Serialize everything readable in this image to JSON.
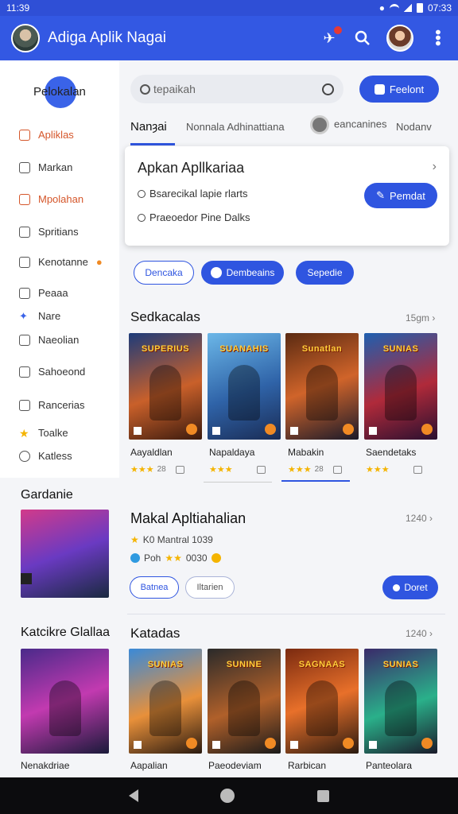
{
  "status": {
    "time": "11:39",
    "right_time": "07:33"
  },
  "appbar": {
    "title": "Adiga Aplik Nagai"
  },
  "sidebar": {
    "logo": "Pelokalan",
    "items": [
      {
        "label": "Apliklas"
      },
      {
        "label": "Markan"
      },
      {
        "label": "Mpolahan"
      },
      {
        "label": "Spritians"
      },
      {
        "label": "Kenotanne"
      },
      {
        "label": "Peaaa"
      },
      {
        "label": "Nare"
      },
      {
        "label": "Naeolian"
      },
      {
        "label": "Sahoeond"
      },
      {
        "label": "Rancerias"
      },
      {
        "label": "Toalke"
      },
      {
        "label": "Katless"
      }
    ]
  },
  "search": {
    "placeholder": "tepaikah",
    "button": "Feelont"
  },
  "tabs": [
    "Nanȝai",
    "Nonnala Adhinattiana",
    "eancanines",
    "Nodanv"
  ],
  "card": {
    "title": "Apkan Apllkariaa",
    "options": [
      "Bsarecikal lapie rlarts",
      "Praeoedor Pine Dalks"
    ],
    "button": "Pemdat"
  },
  "chips": [
    "Dencaka",
    "Dembeains",
    "Sepedie"
  ],
  "section1": {
    "title": "Sedkacalas",
    "more": "15gm",
    "games": [
      {
        "name": "Aayaldlan",
        "poster_title": "SUPERIUS",
        "rating": "28"
      },
      {
        "name": "Napaldaya",
        "poster_title": "SUANAHIS",
        "rating": ""
      },
      {
        "name": "Mabakin",
        "poster_title": "Sunatlan",
        "rating": "28"
      },
      {
        "name": "Saendetaks",
        "poster_title": "SUNIAS",
        "rating": ""
      }
    ]
  },
  "left_section1": {
    "title": "Gardanie"
  },
  "featured": {
    "title": "Makal Apltiahalian",
    "more": "1240",
    "meta1": "K0 Mantral 1039",
    "meta2_prefix": "Poh",
    "meta2_suffix": "0030",
    "chip1": "Batnea",
    "chip2": "Iltarien",
    "button": "Doret"
  },
  "left_section2": {
    "title": "Katcikre Glallaa",
    "item": "Nenakdriae"
  },
  "section2": {
    "title": "Katadas",
    "more": "1240",
    "games": [
      {
        "name": "Aapalian",
        "poster_title": "SUNIAS"
      },
      {
        "name": "Paeodeviam",
        "poster_title": "SUNINE"
      },
      {
        "name": "Rarbican",
        "poster_title": "SAGNAAS"
      },
      {
        "name": "Panteolara",
        "poster_title": "SUNIAS"
      }
    ]
  },
  "colors": {
    "primary": "#2f55e0",
    "appbar": "#3358e3",
    "accent_orange": "#d5562a",
    "star": "#f4b400"
  }
}
